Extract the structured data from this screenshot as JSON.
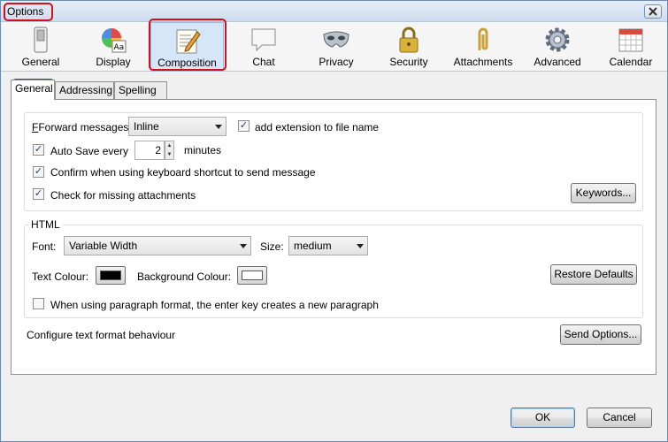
{
  "window": {
    "title": "Options"
  },
  "toolbar": {
    "panes": [
      {
        "label": "General",
        "icon": "general-switch-icon"
      },
      {
        "label": "Display",
        "icon": "display-palette-icon"
      },
      {
        "label": "Composition",
        "icon": "composition-pen-icon",
        "selected": true
      },
      {
        "label": "Chat",
        "icon": "chat-bubble-icon"
      },
      {
        "label": "Privacy",
        "icon": "privacy-mask-icon"
      },
      {
        "label": "Security",
        "icon": "security-padlock-icon"
      },
      {
        "label": "Attachments",
        "icon": "attachments-paperclip-icon"
      },
      {
        "label": "Advanced",
        "icon": "advanced-gear-icon"
      },
      {
        "label": "Calendar",
        "icon": "calendar-icon"
      }
    ]
  },
  "tabs": {
    "general": "General",
    "addressing": "Addressing",
    "spelling": "Spelling",
    "active": "General"
  },
  "general_group": {
    "forward_label": "Forward messages:",
    "forward_value": "Inline",
    "add_extension": {
      "label": "add extension to file name",
      "checked": true
    },
    "auto_save": {
      "label": "Auto Save every",
      "checked": true,
      "value": "2",
      "unit": "minutes"
    },
    "confirm_shortcut": {
      "label": "Confirm when using keyboard shortcut to send message",
      "checked": true
    },
    "check_missing": {
      "label": "Check for missing attachments",
      "checked": true
    },
    "keywords_button": "Keywords..."
  },
  "html_group": {
    "title": "HTML",
    "font_label": "Font:",
    "font_value": "Variable Width",
    "size_label": "Size:",
    "size_value": "medium",
    "text_colour_label": "Text Colour:",
    "text_colour": "#000000",
    "background_colour_label": "Background Colour:",
    "background_colour": "#ffffff",
    "restore_button": "Restore Defaults",
    "paragraph": {
      "label": "When using paragraph format, the enter key creates a new paragraph",
      "checked": false
    }
  },
  "footer_section": {
    "configure_label": "Configure text format behaviour",
    "send_options_button": "Send Options..."
  },
  "dialog_buttons": {
    "ok": "OK",
    "cancel": "Cancel"
  },
  "colors": {
    "highlight": "#d0101a",
    "selected_pane_bg": "#d5e6f8"
  }
}
